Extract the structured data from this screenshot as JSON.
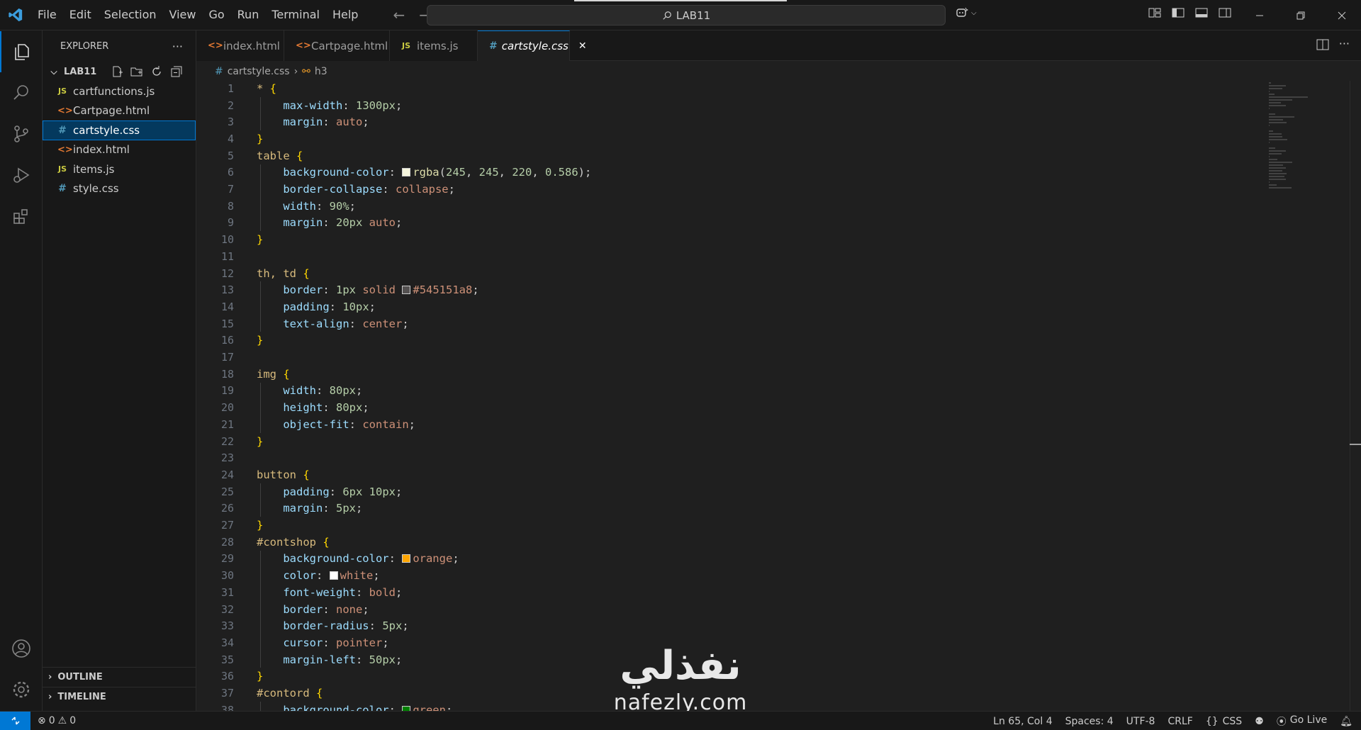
{
  "menu": [
    "File",
    "Edit",
    "Selection",
    "View",
    "Go",
    "Run",
    "Terminal",
    "Help"
  ],
  "command_center": {
    "text": "LAB11"
  },
  "sidebar": {
    "title": "EXPLORER",
    "folder": "LAB11",
    "files": [
      {
        "name": "cartfunctions.js",
        "type": "js",
        "icon": "JS"
      },
      {
        "name": "Cartpage.html",
        "type": "html",
        "icon": "<>"
      },
      {
        "name": "cartstyle.css",
        "type": "css",
        "icon": "#",
        "active": true
      },
      {
        "name": "index.html",
        "type": "html",
        "icon": "<>"
      },
      {
        "name": "items.js",
        "type": "js",
        "icon": "JS"
      },
      {
        "name": "style.css",
        "type": "css",
        "icon": "#"
      }
    ],
    "outline": "OUTLINE",
    "timeline": "TIMELINE"
  },
  "tabs": [
    {
      "label": "index.html",
      "icon": "<>",
      "type": "html"
    },
    {
      "label": "Cartpage.html",
      "icon": "<>",
      "type": "html"
    },
    {
      "label": "items.js",
      "icon": "JS",
      "type": "js"
    },
    {
      "label": "cartstyle.css",
      "icon": "#",
      "type": "css",
      "active": true
    }
  ],
  "breadcrumb": {
    "file": "cartstyle.css",
    "symbol": "h3"
  },
  "code_lines": [
    [
      [
        "* ",
        "sel"
      ],
      [
        "{",
        "brace"
      ]
    ],
    [
      [
        "    ",
        "pun"
      ],
      [
        "max-width",
        "prop"
      ],
      [
        ": ",
        "pun"
      ],
      [
        "1300px",
        "num"
      ],
      [
        ";",
        "pun"
      ]
    ],
    [
      [
        "    ",
        "pun"
      ],
      [
        "margin",
        "prop"
      ],
      [
        ": ",
        "pun"
      ],
      [
        "auto",
        "val"
      ],
      [
        ";",
        "pun"
      ]
    ],
    [
      [
        "}",
        "brace"
      ]
    ],
    [
      [
        "table ",
        "sel"
      ],
      [
        "{",
        "brace"
      ]
    ],
    [
      [
        "    ",
        "pun"
      ],
      [
        "background-color",
        "prop"
      ],
      [
        ": ",
        "pun"
      ],
      [
        "#f5f5dc",
        "swatch"
      ],
      [
        "rgba",
        "fn"
      ],
      [
        "(",
        "pun"
      ],
      [
        "245",
        "num"
      ],
      [
        ", ",
        "pun"
      ],
      [
        "245",
        "num"
      ],
      [
        ", ",
        "pun"
      ],
      [
        "220",
        "num"
      ],
      [
        ", ",
        "pun"
      ],
      [
        "0.586",
        "num"
      ],
      [
        ");",
        "pun"
      ]
    ],
    [
      [
        "    ",
        "pun"
      ],
      [
        "border-collapse",
        "prop"
      ],
      [
        ": ",
        "pun"
      ],
      [
        "collapse",
        "val"
      ],
      [
        ";",
        "pun"
      ]
    ],
    [
      [
        "    ",
        "pun"
      ],
      [
        "width",
        "prop"
      ],
      [
        ": ",
        "pun"
      ],
      [
        "90%",
        "num"
      ],
      [
        ";",
        "pun"
      ]
    ],
    [
      [
        "    ",
        "pun"
      ],
      [
        "margin",
        "prop"
      ],
      [
        ": ",
        "pun"
      ],
      [
        "20px",
        "num"
      ],
      [
        " ",
        "pun"
      ],
      [
        "auto",
        "val"
      ],
      [
        ";",
        "pun"
      ]
    ],
    [
      [
        "}",
        "brace"
      ]
    ],
    [],
    [
      [
        "th, td ",
        "sel"
      ],
      [
        "{",
        "brace"
      ]
    ],
    [
      [
        "    ",
        "pun"
      ],
      [
        "border",
        "prop"
      ],
      [
        ": ",
        "pun"
      ],
      [
        "1px",
        "num"
      ],
      [
        " ",
        "pun"
      ],
      [
        "solid",
        "val"
      ],
      [
        " ",
        "pun"
      ],
      [
        "#545151",
        "swatch"
      ],
      [
        "#545151a8",
        "val"
      ],
      [
        ";",
        "pun"
      ]
    ],
    [
      [
        "    ",
        "pun"
      ],
      [
        "padding",
        "prop"
      ],
      [
        ": ",
        "pun"
      ],
      [
        "10px",
        "num"
      ],
      [
        ";",
        "pun"
      ]
    ],
    [
      [
        "    ",
        "pun"
      ],
      [
        "text-align",
        "prop"
      ],
      [
        ": ",
        "pun"
      ],
      [
        "center",
        "val"
      ],
      [
        ";",
        "pun"
      ]
    ],
    [
      [
        "}",
        "brace"
      ]
    ],
    [],
    [
      [
        "img ",
        "sel"
      ],
      [
        "{",
        "brace"
      ]
    ],
    [
      [
        "    ",
        "pun"
      ],
      [
        "width",
        "prop"
      ],
      [
        ": ",
        "pun"
      ],
      [
        "80px",
        "num"
      ],
      [
        ";",
        "pun"
      ]
    ],
    [
      [
        "    ",
        "pun"
      ],
      [
        "height",
        "prop"
      ],
      [
        ": ",
        "pun"
      ],
      [
        "80px",
        "num"
      ],
      [
        ";",
        "pun"
      ]
    ],
    [
      [
        "    ",
        "pun"
      ],
      [
        "object-fit",
        "prop"
      ],
      [
        ": ",
        "pun"
      ],
      [
        "contain",
        "val"
      ],
      [
        ";",
        "pun"
      ]
    ],
    [
      [
        "}",
        "brace"
      ]
    ],
    [],
    [
      [
        "button ",
        "sel"
      ],
      [
        "{",
        "brace"
      ]
    ],
    [
      [
        "    ",
        "pun"
      ],
      [
        "padding",
        "prop"
      ],
      [
        ": ",
        "pun"
      ],
      [
        "6px",
        "num"
      ],
      [
        " ",
        "pun"
      ],
      [
        "10px",
        "num"
      ],
      [
        ";",
        "pun"
      ]
    ],
    [
      [
        "    ",
        "pun"
      ],
      [
        "margin",
        "prop"
      ],
      [
        ": ",
        "pun"
      ],
      [
        "5px",
        "num"
      ],
      [
        ";",
        "pun"
      ]
    ],
    [
      [
        "}",
        "brace"
      ]
    ],
    [
      [
        "#contshop ",
        "sel"
      ],
      [
        "{",
        "brace"
      ]
    ],
    [
      [
        "    ",
        "pun"
      ],
      [
        "background-color",
        "prop"
      ],
      [
        ": ",
        "pun"
      ],
      [
        "#ffa500",
        "swatch"
      ],
      [
        "orange",
        "val"
      ],
      [
        ";",
        "pun"
      ]
    ],
    [
      [
        "    ",
        "pun"
      ],
      [
        "color",
        "prop"
      ],
      [
        ": ",
        "pun"
      ],
      [
        "#ffffff",
        "swatch"
      ],
      [
        "white",
        "val"
      ],
      [
        ";",
        "pun"
      ]
    ],
    [
      [
        "    ",
        "pun"
      ],
      [
        "font-weight",
        "prop"
      ],
      [
        ": ",
        "pun"
      ],
      [
        "bold",
        "val"
      ],
      [
        ";",
        "pun"
      ]
    ],
    [
      [
        "    ",
        "pun"
      ],
      [
        "border",
        "prop"
      ],
      [
        ": ",
        "pun"
      ],
      [
        "none",
        "val"
      ],
      [
        ";",
        "pun"
      ]
    ],
    [
      [
        "    ",
        "pun"
      ],
      [
        "border-radius",
        "prop"
      ],
      [
        ": ",
        "pun"
      ],
      [
        "5px",
        "num"
      ],
      [
        ";",
        "pun"
      ]
    ],
    [
      [
        "    ",
        "pun"
      ],
      [
        "cursor",
        "prop"
      ],
      [
        ": ",
        "pun"
      ],
      [
        "pointer",
        "val"
      ],
      [
        ";",
        "pun"
      ]
    ],
    [
      [
        "    ",
        "pun"
      ],
      [
        "margin-left",
        "prop"
      ],
      [
        ": ",
        "pun"
      ],
      [
        "50px",
        "num"
      ],
      [
        ";",
        "pun"
      ]
    ],
    [
      [
        "}",
        "brace"
      ]
    ],
    [
      [
        "#contord ",
        "sel"
      ],
      [
        "{",
        "brace"
      ]
    ],
    [
      [
        "    ",
        "pun"
      ],
      [
        "background-color",
        "prop"
      ],
      [
        ": ",
        "pun"
      ],
      [
        "#008000",
        "swatch"
      ],
      [
        "green",
        "val"
      ],
      [
        ";",
        "pun"
      ]
    ]
  ],
  "status": {
    "errors": "0",
    "warnings": "0",
    "position": "Ln 65, Col 4",
    "spaces": "Spaces: 4",
    "encoding": "UTF-8",
    "eol": "CRLF",
    "language": "CSS",
    "golive": "Go Live"
  },
  "watermark": {
    "arabic": "نفذلي",
    "latin": "nafezly.com"
  },
  "colors": {
    "accent": "#0078d4",
    "background": "#1f1f1f",
    "chrome": "#181818"
  }
}
